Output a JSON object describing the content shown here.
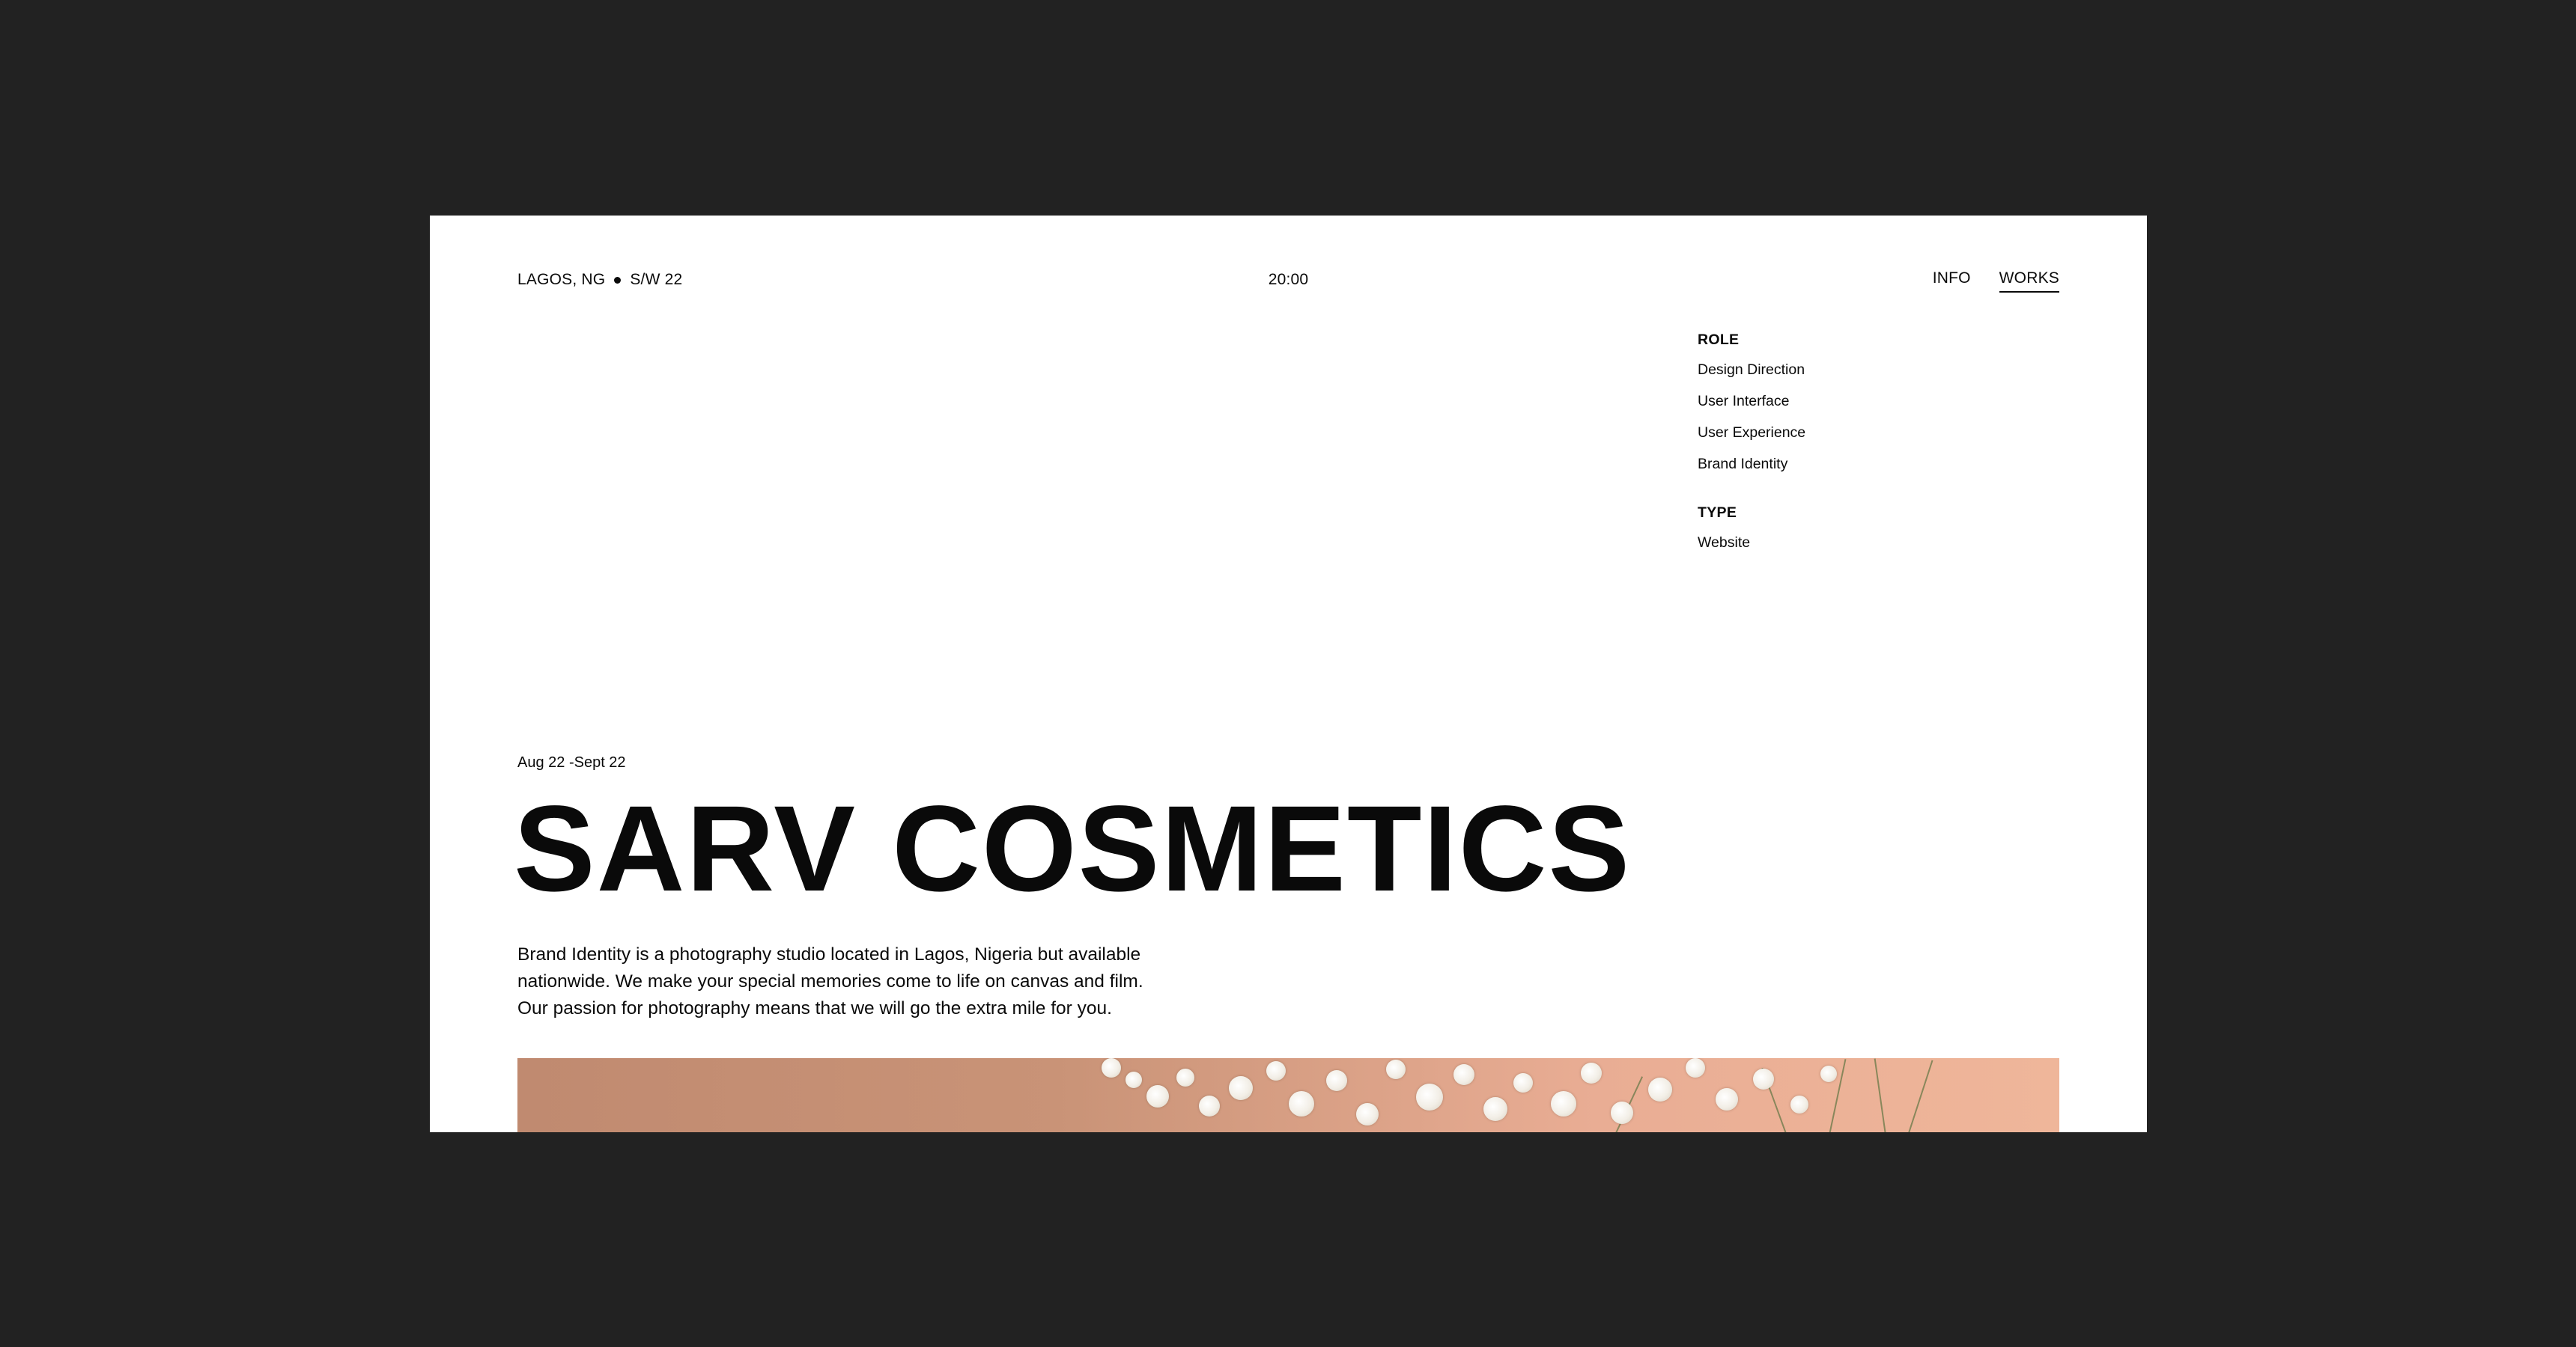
{
  "header": {
    "location": "LAGOS, NG",
    "season": "S/W 22",
    "time": "20:00",
    "nav": [
      {
        "label": "INFO",
        "active": false
      },
      {
        "label": "WORKS",
        "active": true
      }
    ]
  },
  "meta": {
    "role_heading": "ROLE",
    "roles": [
      "Design Direction",
      "User Interface",
      "User Experience",
      "Brand Identity"
    ],
    "type_heading": "TYPE",
    "type": "Website"
  },
  "project": {
    "date": "Aug 22 -Sept 22",
    "title": "SARV COSMETICS",
    "description": "Brand Identity is a photography studio located in Lagos, Nigeria but available nationwide. We make your special memories come to life on canvas and film. Our passion for photography means that we will go the extra mile for you."
  },
  "colors": {
    "backdrop": "#222222",
    "page": "#ffffff",
    "text": "#0a0a0a",
    "hero_left": "#c08a70",
    "hero_right": "#efb69a"
  }
}
